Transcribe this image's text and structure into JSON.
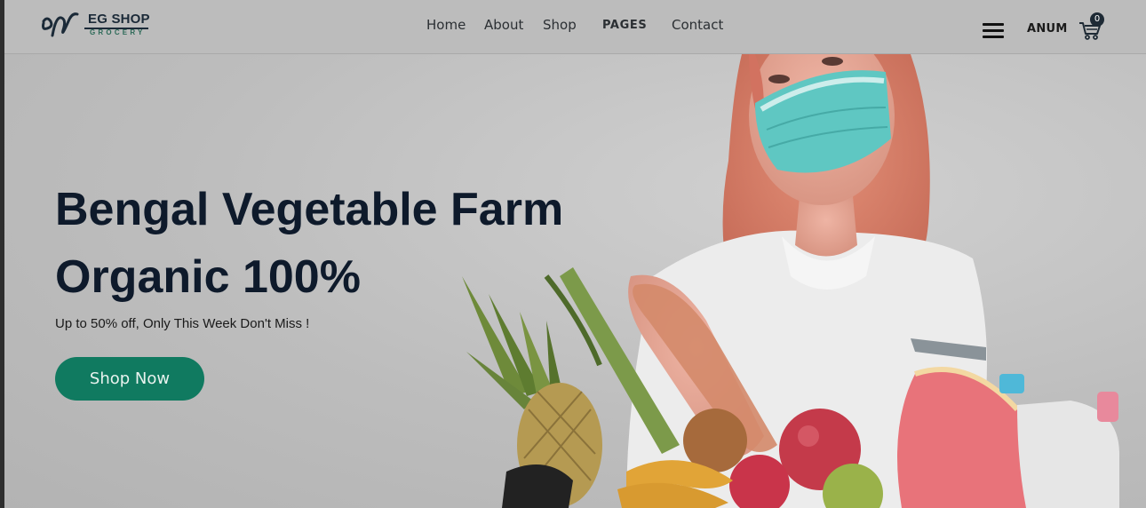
{
  "brand": {
    "name": "EG SHOP",
    "tagline": "GROCERY",
    "accent_color": "#107a60"
  },
  "nav": {
    "items": [
      "Home",
      "About",
      "Shop",
      "PAGES",
      "Contact"
    ]
  },
  "header_right": {
    "menu_icon": "hamburger-icon",
    "user_label": "ANUM",
    "cart_icon": "shopping-cart-icon",
    "cart_count": "0"
  },
  "hero": {
    "title_line1": "Bengal Vegetable Farm",
    "title_line2": "Organic 100%",
    "subtitle": "Up to 50% off, Only This Week Don't Miss !",
    "cta_label": "Shop Now",
    "image": "woman-with-mask-holding-groceries"
  }
}
